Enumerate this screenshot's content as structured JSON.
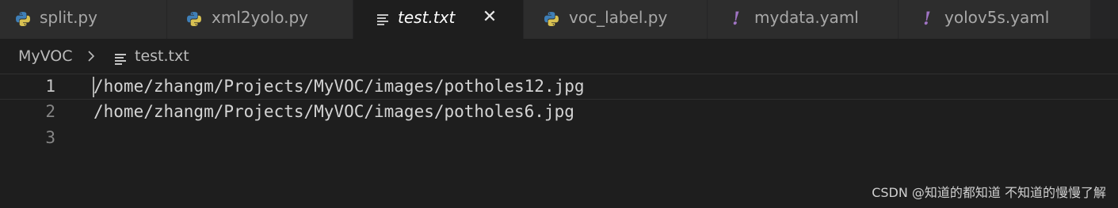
{
  "tabs": [
    {
      "label": "split.py",
      "icon": "python-icon"
    },
    {
      "label": "xml2yolo.py",
      "icon": "python-icon"
    },
    {
      "label": "test.txt",
      "icon": "text-file-icon",
      "active": true,
      "close_label": "✕"
    },
    {
      "label": "voc_label.py",
      "icon": "python-icon"
    },
    {
      "label": "mydata.yaml",
      "icon": "yaml-icon",
      "icon_glyph": "!"
    },
    {
      "label": "yolov5s.yaml",
      "icon": "yaml-icon",
      "icon_glyph": "!"
    }
  ],
  "breadcrumb": {
    "folder": "MyVOC",
    "file": "test.txt"
  },
  "editor": {
    "lines": [
      {
        "number": "1",
        "text": "/home/zhangm/Projects/MyVOC/images/potholes12.jpg"
      },
      {
        "number": "2",
        "text": "/home/zhangm/Projects/MyVOC/images/potholes6.jpg"
      },
      {
        "number": "3",
        "text": ""
      }
    ]
  },
  "watermark": "CSDN @知道的都知道 不知道的慢慢了解",
  "colors": {
    "tab_bar": "#252526",
    "inactive_tab": "#2d2d2d",
    "editor_bg": "#1e1e1e",
    "python_blue": "#3f7fb7",
    "python_yellow": "#d8c152",
    "yaml_purple": "#a074c4"
  }
}
